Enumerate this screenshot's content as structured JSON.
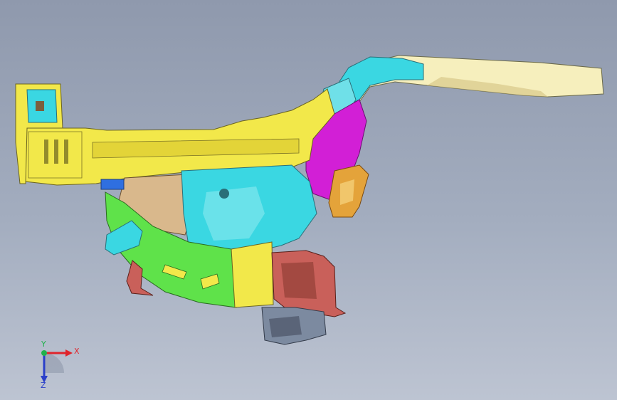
{
  "viewer": {
    "background_top": "#8f99ad",
    "background_bottom": "#bdc4d2"
  },
  "model": {
    "description_icon": "car-body-front-structure-assembly",
    "part_colors": {
      "yellow": "#f2e84a",
      "cyan": "#3ad7e2",
      "magenta": "#d21fd6",
      "green": "#5fe24a",
      "cream": "#f6efbd",
      "tan": "#d9b88c",
      "red": "#c9605a",
      "steel": "#7c8aa0"
    }
  },
  "triad": {
    "x_label": "X",
    "y_label": "Y",
    "z_label": "Z",
    "x_color": "#e0242b",
    "y_color": "#22b14c",
    "z_color": "#2a3fc9"
  }
}
